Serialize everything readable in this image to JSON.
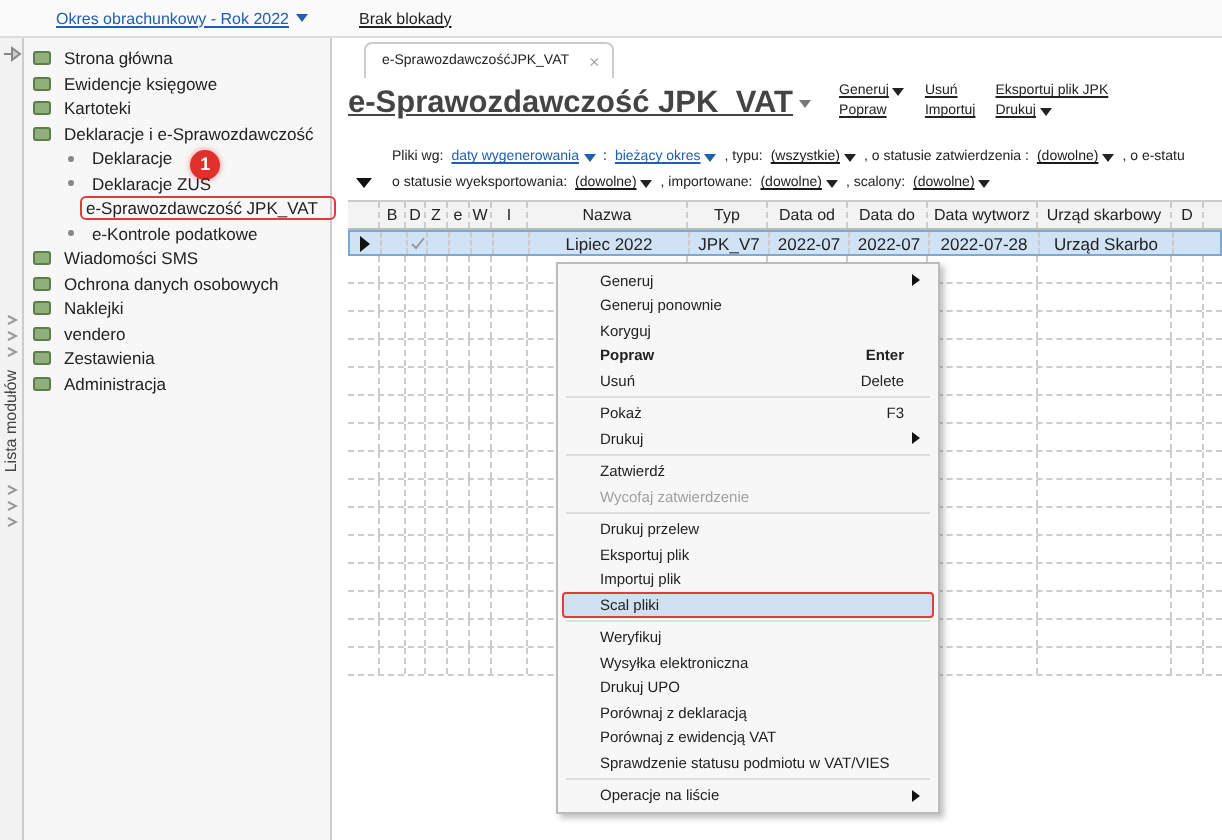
{
  "top_bar": {
    "period_link": "Okres obrachunkowy - Rok 2022",
    "lock_link": "Brak blokady"
  },
  "side_strip": {
    "label": "Lista modułów"
  },
  "sidebar": {
    "items": [
      {
        "label": "Strona główna"
      },
      {
        "label": "Ewidencje księgowe"
      },
      {
        "label": "Kartoteki"
      },
      {
        "label": "Deklaracje i e-Sprawozdawczość",
        "children": [
          {
            "label": "Deklaracje",
            "highlighted": false
          },
          {
            "label": "Deklaracje ZUS",
            "highlighted": false
          },
          {
            "label": "e-Sprawozdawczość JPK_VAT",
            "highlighted": true
          },
          {
            "label": "e-Kontrole podatkowe",
            "highlighted": false
          }
        ]
      },
      {
        "label": "Wiadomości SMS"
      },
      {
        "label": "Ochrona danych osobowych"
      },
      {
        "label": "Naklejki"
      },
      {
        "label": "vendero"
      },
      {
        "label": "Zestawienia"
      },
      {
        "label": "Administracja"
      }
    ]
  },
  "callout": {
    "number": "1"
  },
  "tab": {
    "label": "e-SprawozdawczośćJPK_VAT",
    "close": "×"
  },
  "title": "e-Sprawozdawczość JPK_VAT",
  "actions": [
    {
      "label": "Generuj",
      "dropdown": true
    },
    {
      "label": "Usuń",
      "dropdown": false
    },
    {
      "label": "Eksportuj plik JPK",
      "dropdown": false
    },
    {
      "label": "Popraw",
      "dropdown": false
    },
    {
      "label": "Importuj",
      "dropdown": false
    },
    {
      "label": "Drukuj",
      "dropdown": true
    }
  ],
  "filters": [
    [
      {
        "kind": "text",
        "text": "Pliki wg:"
      },
      {
        "kind": "link",
        "text": "daty wygenerowania"
      },
      {
        "kind": "text",
        "text": ":"
      },
      {
        "kind": "link",
        "text": "bieżący okres"
      },
      {
        "kind": "text",
        "text": ", typu:"
      },
      {
        "kind": "link",
        "text": "(wszystkie)"
      },
      {
        "kind": "text",
        "text": ", o statusie zatwierdzenia :"
      },
      {
        "kind": "link",
        "text": "(dowolne)"
      },
      {
        "kind": "text",
        "text": ", o e-statu"
      }
    ],
    [
      {
        "kind": "text",
        "text": "o statusie wyeksportowania:"
      },
      {
        "kind": "link",
        "text": "(dowolne)"
      },
      {
        "kind": "text",
        "text": ", importowane:"
      },
      {
        "kind": "link",
        "text": "(dowolne)"
      },
      {
        "kind": "text",
        "text": ", scalony:"
      },
      {
        "kind": "link",
        "text": "(dowolne)"
      }
    ]
  ],
  "table": {
    "columns": [
      "B",
      "D",
      "Z",
      "e",
      "W",
      "I",
      "Nazwa",
      "Typ",
      "Data od",
      "Data do",
      "Data wytworz",
      "Urząd skarbowy",
      "D"
    ],
    "rows": [
      {
        "selected": true,
        "checked": true,
        "cells": [
          "",
          "",
          "",
          "",
          "",
          "",
          "Lipiec 2022",
          "JPK_V7",
          "2022-07",
          "2022-07",
          "2022-07-28",
          "Urząd Skarbo"
        ]
      }
    ]
  },
  "context_menu": [
    {
      "kind": "item",
      "label": "Generuj",
      "submenu": true,
      "bold": false,
      "disabled": false,
      "highlighted": false
    },
    {
      "kind": "item",
      "label": "Generuj ponownie",
      "submenu": false,
      "bold": false,
      "disabled": false,
      "highlighted": false
    },
    {
      "kind": "item",
      "label": "Koryguj",
      "submenu": false,
      "bold": false,
      "disabled": false,
      "highlighted": false
    },
    {
      "kind": "item",
      "label": "Popraw",
      "shortcut": "Enter",
      "submenu": false,
      "bold": true,
      "disabled": false,
      "highlighted": false
    },
    {
      "kind": "item",
      "label": "Usuń",
      "shortcut": "Delete",
      "submenu": false,
      "bold": false,
      "disabled": false,
      "highlighted": false
    },
    {
      "kind": "separator"
    },
    {
      "kind": "item",
      "label": "Pokaż",
      "shortcut": "F3",
      "submenu": false,
      "bold": false,
      "disabled": false,
      "highlighted": false
    },
    {
      "kind": "item",
      "label": "Drukuj",
      "submenu": true,
      "bold": false,
      "disabled": false,
      "highlighted": false
    },
    {
      "kind": "separator"
    },
    {
      "kind": "item",
      "label": "Zatwierdź",
      "submenu": false,
      "bold": false,
      "disabled": false,
      "highlighted": false
    },
    {
      "kind": "item",
      "label": "Wycofaj zatwierdzenie",
      "submenu": false,
      "bold": false,
      "disabled": true,
      "highlighted": false
    },
    {
      "kind": "separator"
    },
    {
      "kind": "item",
      "label": "Drukuj przelew",
      "submenu": false,
      "bold": false,
      "disabled": false,
      "highlighted": false
    },
    {
      "kind": "item",
      "label": "Eksportuj plik",
      "submenu": false,
      "bold": false,
      "disabled": false,
      "highlighted": false
    },
    {
      "kind": "item",
      "label": "Importuj plik",
      "submenu": false,
      "bold": false,
      "disabled": false,
      "highlighted": false
    },
    {
      "kind": "item",
      "label": "Scal pliki",
      "submenu": false,
      "bold": false,
      "disabled": false,
      "highlighted": true
    },
    {
      "kind": "separator"
    },
    {
      "kind": "item",
      "label": "Weryfikuj",
      "submenu": false,
      "bold": false,
      "disabled": false,
      "highlighted": false
    },
    {
      "kind": "item",
      "label": "Wysyłka elektroniczna",
      "submenu": false,
      "bold": false,
      "disabled": false,
      "highlighted": false
    },
    {
      "kind": "item",
      "label": "Drukuj UPO",
      "submenu": false,
      "bold": false,
      "disabled": false,
      "highlighted": false
    },
    {
      "kind": "item",
      "label": "Porównaj z deklaracją",
      "submenu": false,
      "bold": false,
      "disabled": false,
      "highlighted": false
    },
    {
      "kind": "item",
      "label": "Porównaj z ewidencją VAT",
      "submenu": false,
      "bold": false,
      "disabled": false,
      "highlighted": false
    },
    {
      "kind": "item",
      "label": "Sprawdzenie statusu podmiotu w VAT/VIES",
      "submenu": false,
      "bold": false,
      "disabled": false,
      "highlighted": false
    },
    {
      "kind": "separator"
    },
    {
      "kind": "item",
      "label": "Operacje na liście",
      "submenu": true,
      "bold": false,
      "disabled": false,
      "highlighted": false
    }
  ]
}
